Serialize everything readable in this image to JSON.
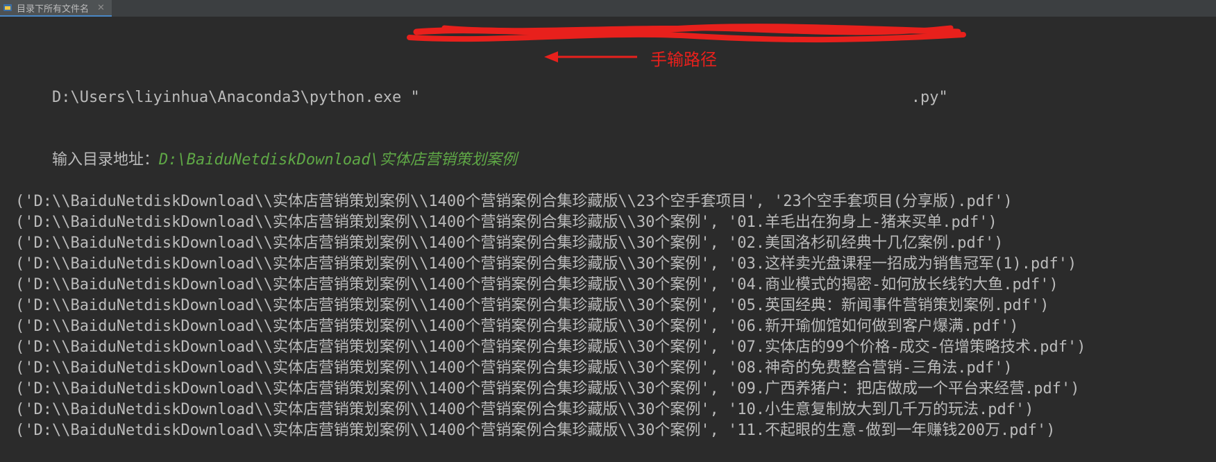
{
  "tab": {
    "title": "目录下所有文件名",
    "close": "✕"
  },
  "console": {
    "command_prefix": "D:\\Users\\liyinhua\\Anaconda3\\python.exe \"",
    "command_suffix": ".py\"",
    "prompt_label": "输入目录地址：",
    "prompt_value": "D:\\BaiduNetdiskDownload\\实体店营销策划案例",
    "output_lines": [
      "('D:\\\\BaiduNetdiskDownload\\\\实体店营销策划案例\\\\1400个营销案例合集珍藏版\\\\23个空手套项目', '23个空手套项目(分享版).pdf')",
      "('D:\\\\BaiduNetdiskDownload\\\\实体店营销策划案例\\\\1400个营销案例合集珍藏版\\\\30个案例', '01.羊毛出在狗身上-猪来买单.pdf')",
      "('D:\\\\BaiduNetdiskDownload\\\\实体店营销策划案例\\\\1400个营销案例合集珍藏版\\\\30个案例', '02.美国洛杉矶经典十几亿案例.pdf')",
      "('D:\\\\BaiduNetdiskDownload\\\\实体店营销策划案例\\\\1400个营销案例合集珍藏版\\\\30个案例', '03.这样卖光盘课程一招成为销售冠军(1).pdf')",
      "('D:\\\\BaiduNetdiskDownload\\\\实体店营销策划案例\\\\1400个营销案例合集珍藏版\\\\30个案例', '04.商业模式的揭密-如何放长线钓大鱼.pdf')",
      "('D:\\\\BaiduNetdiskDownload\\\\实体店营销策划案例\\\\1400个营销案例合集珍藏版\\\\30个案例', '05.英国经典：新闻事件营销策划案例.pdf')",
      "('D:\\\\BaiduNetdiskDownload\\\\实体店营销策划案例\\\\1400个营销案例合集珍藏版\\\\30个案例', '06.新开瑜伽馆如何做到客户爆满.pdf')",
      "('D:\\\\BaiduNetdiskDownload\\\\实体店营销策划案例\\\\1400个营销案例合集珍藏版\\\\30个案例', '07.实体店的99个价格-成交-倍增策略技术.pdf')",
      "('D:\\\\BaiduNetdiskDownload\\\\实体店营销策划案例\\\\1400个营销案例合集珍藏版\\\\30个案例', '08.神奇的免费整合营销-三角法.pdf')",
      "('D:\\\\BaiduNetdiskDownload\\\\实体店营销策划案例\\\\1400个营销案例合集珍藏版\\\\30个案例', '09.广西养猪户：把店做成一个平台来经营.pdf')",
      "('D:\\\\BaiduNetdiskDownload\\\\实体店营销策划案例\\\\1400个营销案例合集珍藏版\\\\30个案例', '10.小生意复制放大到几千万的玩法.pdf')",
      "('D:\\\\BaiduNetdiskDownload\\\\实体店营销策划案例\\\\1400个营销案例合集珍藏版\\\\30个案例', '11.不起眼的生意-做到一年赚钱200万.pdf')"
    ]
  },
  "annotation": {
    "text": "手输路径"
  },
  "colors": {
    "background": "#2b2b2b",
    "text": "#bbbbbb",
    "input": "#5fa846",
    "annotation": "#e8201c"
  },
  "icons": {
    "tab": "python-console-icon",
    "close": "close-icon"
  }
}
